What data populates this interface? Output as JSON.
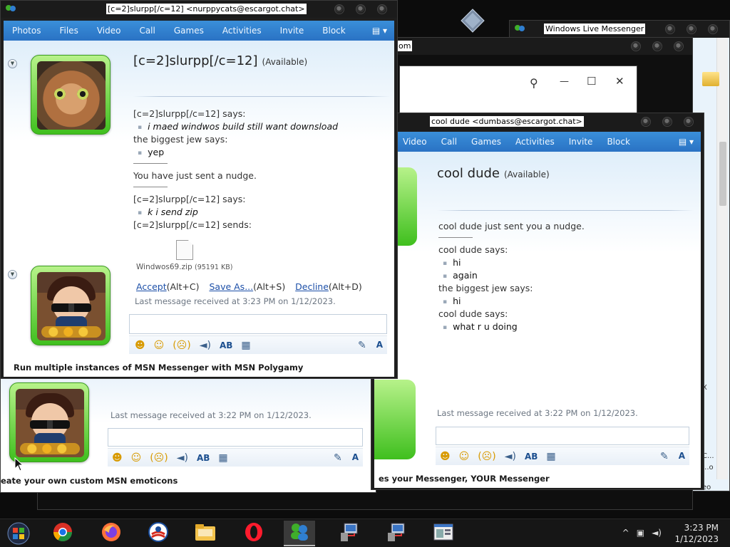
{
  "desktop": {
    "shortcut_icon": "diamond-shortcut-icon"
  },
  "wlm_main": {
    "title": "Windows Live Messenger",
    "side_snippets": [
      "X",
      "C...",
      "...o",
      "eo"
    ]
  },
  "browser_bg": {
    "title_fragment": "om",
    "search_icon": "search-icon",
    "min": "—",
    "max": "☐",
    "close": "✕"
  },
  "chat1": {
    "title": "[c=2]slurpp[/c=12] <nurppycats@escargot.chat>",
    "menu": [
      "Photos",
      "Files",
      "Video",
      "Call",
      "Games",
      "Activities",
      "Invite",
      "Block"
    ],
    "contact_name": "[c=2]slurpp[/c=12]",
    "contact_status": "(Available)",
    "messages": [
      {
        "kind": "says",
        "text": "[c=2]slurpp[/c=12] says:"
      },
      {
        "kind": "msg",
        "italic": true,
        "text": "i maed windwos build still want downsload"
      },
      {
        "kind": "says",
        "text": "the biggest jew says:"
      },
      {
        "kind": "msg",
        "italic": false,
        "text": "yep"
      },
      {
        "kind": "sep"
      },
      {
        "kind": "says",
        "text": "You have just sent a nudge."
      },
      {
        "kind": "sep"
      },
      {
        "kind": "says",
        "text": "[c=2]slurpp[/c=12] says:"
      },
      {
        "kind": "msg",
        "italic": true,
        "text": "k i send zip"
      },
      {
        "kind": "says",
        "text": "[c=2]slurpp[/c=12] sends:"
      }
    ],
    "file": {
      "name": "Windwos69.zip",
      "size": "(95191 KB)"
    },
    "file_actions": {
      "accept": "Accept",
      "accept_key": "(Alt+C)",
      "save_as": "Save As...",
      "save_as_key": "(Alt+S)",
      "decline": "Decline",
      "decline_key": "(Alt+D)"
    },
    "last_message": "Last message received at 3:23 PM on 1/12/2023.",
    "ad": "Run multiple instances of MSN Messenger with MSN Polygamy"
  },
  "chat2": {
    "title": "cool dude <dumbass@escargot.chat>",
    "menu": [
      "Video",
      "Call",
      "Games",
      "Activities",
      "Invite",
      "Block"
    ],
    "contact_name": "cool dude",
    "contact_status": "(Available)",
    "messages": [
      {
        "kind": "says",
        "text": "cool dude just sent you a nudge."
      },
      {
        "kind": "sep"
      },
      {
        "kind": "says",
        "text": "cool dude says:"
      },
      {
        "kind": "msg",
        "italic": false,
        "text": "hi"
      },
      {
        "kind": "msg",
        "italic": false,
        "text": "again"
      },
      {
        "kind": "says",
        "text": "the biggest jew says:"
      },
      {
        "kind": "msg",
        "italic": false,
        "text": "hi"
      },
      {
        "kind": "says",
        "text": "cool dude says:"
      },
      {
        "kind": "msg",
        "italic": false,
        "text": "what r u doing"
      }
    ],
    "last_message": "Last message received at 3:22 PM on 1/12/2023.",
    "ad": "es your Messenger, YOUR Messenger"
  },
  "chat3": {
    "last_message": "Last message received at 3:22 PM on 1/12/2023.",
    "ad": "eate your own custom MSN emoticons"
  },
  "toolbar": {
    "emoticon": "☻",
    "wink": "☺",
    "nudge": "(☹)",
    "voice": "◄)",
    "font_tools": "AB",
    "bg": "▦",
    "dropdown": "▾",
    "handwriting": "✎",
    "font": "A"
  },
  "taskbar": {
    "apps": [
      {
        "name": "chrome-icon",
        "active": false
      },
      {
        "name": "firefox-icon",
        "active": false
      },
      {
        "name": "campaign-icon",
        "active": false
      },
      {
        "name": "file-explorer-icon",
        "active": false
      },
      {
        "name": "opera-icon",
        "active": false
      },
      {
        "name": "messenger-icon",
        "active": true
      },
      {
        "name": "network-setup-icon",
        "active": false
      },
      {
        "name": "network-setup-2-icon",
        "active": false
      },
      {
        "name": "control-panel-icon",
        "active": false
      }
    ],
    "tray_chevron": "^",
    "time": "3:23 PM",
    "date": "1/12/2023"
  }
}
